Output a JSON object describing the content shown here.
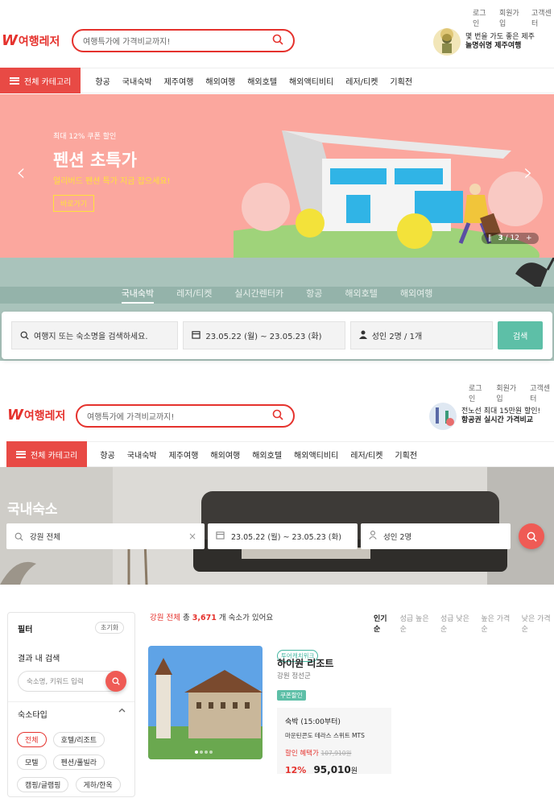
{
  "screen1": {
    "top_links": [
      "로그인",
      "회원가입",
      "고객센터"
    ],
    "logo": {
      "mark": "W",
      "name": "여행레저"
    },
    "search": {
      "placeholder": "여행특가에 가격비교까지!"
    },
    "promo": {
      "line1": "몇 번을 가도 좋은 제주",
      "line2": "놀명쉬명 제주여행"
    },
    "nav": {
      "all_category": "전체 카테고리",
      "items": [
        "항공",
        "국내숙박",
        "제주여행",
        "해외여행",
        "해외호텔",
        "해외액티비티",
        "레저/티켓",
        "기획전"
      ]
    },
    "hero": {
      "kicker": "최대 12% 쿠폰 할인",
      "title": "펜션 초특가",
      "subtitle": "얼리버드 펜션 특가 지금 잡으세요!",
      "button": "바로가기",
      "pager": {
        "current": "3",
        "total": "12"
      },
      "prev_glyph": "‹",
      "next_glyph": "›"
    },
    "tabs": [
      {
        "label": "국내숙박",
        "active": true
      },
      {
        "label": "레저/티켓",
        "active": false
      },
      {
        "label": "실시간렌터카",
        "active": false
      },
      {
        "label": "항공",
        "active": false
      },
      {
        "label": "해외호텔",
        "active": false
      },
      {
        "label": "해외여행",
        "active": false
      }
    ],
    "search_panel": {
      "destination_placeholder": "여행지 또는 숙소명을 검색하세요.",
      "dates": "23.05.22 (월) ~ 23.05.23 (화)",
      "guests": "성인 2명 / 1개",
      "search_button": "검색"
    }
  },
  "screen2": {
    "top_links": [
      "로그인",
      "회원가입",
      "고객센터"
    ],
    "logo": {
      "mark": "W",
      "name": "여행레저"
    },
    "search": {
      "placeholder": "여행특가에 가격비교까지!"
    },
    "promo": {
      "line1": "전노선 최대 15만원 할인!",
      "line2": "항공권 실시간 가격비교"
    },
    "nav": {
      "all_category": "전체 카테고리",
      "items": [
        "항공",
        "국내숙박",
        "제주여행",
        "해외여행",
        "해외호텔",
        "해외액티비티",
        "레저/티켓",
        "기획전"
      ]
    },
    "hero": {
      "title": "국내숙소",
      "region": "강원 전체",
      "clear_glyph": "×",
      "dates": "23.05.22 (월) ~ 23.05.23 (화)",
      "guests": "성인 2명"
    },
    "filter": {
      "title": "필터",
      "reset": "초기화",
      "in_result_search": "결과 내 검색",
      "keyword_placeholder": "숙소명, 키워드 입력",
      "lodging_type": "숙소타입",
      "types": [
        {
          "label": "전체",
          "selected": true
        },
        {
          "label": "호텔/리조트",
          "selected": false
        },
        {
          "label": "모텔",
          "selected": false
        },
        {
          "label": "펜션/풀빌라",
          "selected": false
        },
        {
          "label": "캠핑/글램핑",
          "selected": false
        },
        {
          "label": "게하/한옥",
          "selected": false
        }
      ]
    },
    "results": {
      "region": "강원 전체",
      "total_label": "총",
      "count": "3,671",
      "suffix": "개 숙소가 있어요",
      "sort": [
        {
          "label": "인기순",
          "active": true
        },
        {
          "label": "성급 높은순",
          "active": false
        },
        {
          "label": "성급 낮은순",
          "active": false
        },
        {
          "label": "높은 가격순",
          "active": false
        },
        {
          "label": "낮은 가격순",
          "active": false
        }
      ]
    },
    "listing": {
      "badge": "투어캐치위크",
      "name": "하이원 리조트",
      "location": "강원 정선군",
      "coupon": "쿠폰할인",
      "stay": "숙박 (15:00부터)",
      "room": "마운틴콘도 테라스 스위트 MTS",
      "benefit_label": "할인 혜택가",
      "original_price": "107,910원",
      "discount": "12%",
      "price": "95,010",
      "won": "원"
    }
  }
}
